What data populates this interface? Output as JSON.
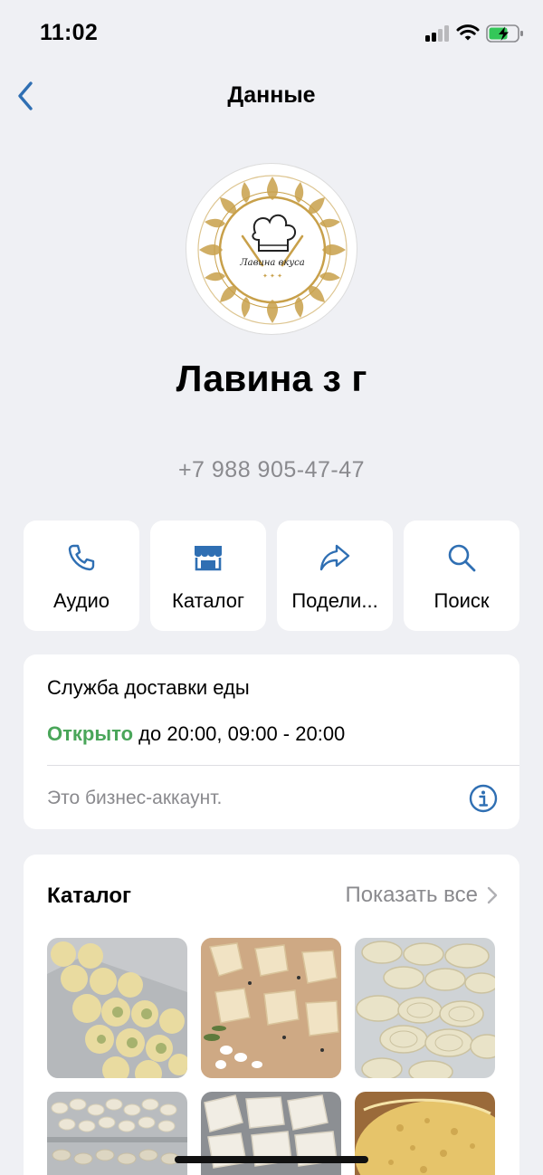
{
  "status_bar": {
    "time": "11:02"
  },
  "nav": {
    "title": "Данные"
  },
  "profile": {
    "logo_text": "Лавина вкуса",
    "name": "Лавина з г",
    "phone": "+7 988 905-47-47"
  },
  "actions": [
    {
      "label": "Аудио",
      "icon": "phone-icon"
    },
    {
      "label": "Каталог",
      "icon": "storefront-icon"
    },
    {
      "label": "Подели...",
      "icon": "share-icon"
    },
    {
      "label": "Поиск",
      "icon": "search-icon"
    }
  ],
  "info": {
    "category": "Служба доставки еды",
    "status": "Открыто",
    "hours": "до 20:00, 09:00 - 20:00",
    "business_note": "Это бизнес-аккаунт."
  },
  "catalog": {
    "title": "Каталог",
    "show_all": "Показать все"
  },
  "colors": {
    "accent": "#2f6fb3",
    "open_green": "#4aa65a",
    "secondary_text": "#8a8a8e",
    "background": "#eff0f4",
    "logo_gold": "#c8a04a"
  }
}
